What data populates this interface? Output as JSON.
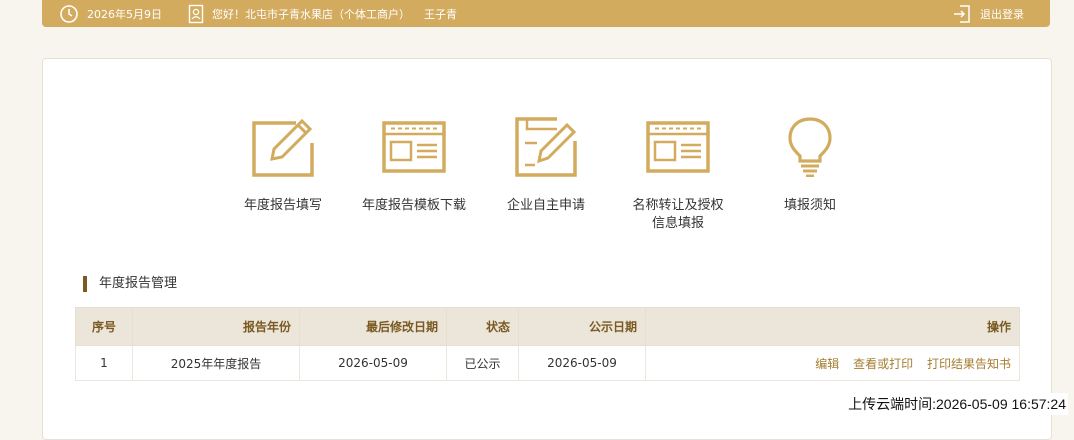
{
  "topbar": {
    "date": "2026年5月9日",
    "greeting": "您好！北屯市子青水果店（个体工商户）",
    "user": "王子青",
    "logout": "退出登录"
  },
  "menu": [
    {
      "label": "年度报告填写",
      "icon": "edit-form-icon"
    },
    {
      "label": "年度报告模板下载",
      "icon": "template-window-icon"
    },
    {
      "label": "企业自主申请",
      "icon": "apply-edit-icon"
    },
    {
      "label": "名称转让及授权信息填报",
      "icon": "template-window-icon"
    },
    {
      "label": "填报须知",
      "icon": "lightbulb-icon"
    }
  ],
  "section": {
    "title": "年度报告管理"
  },
  "table": {
    "headers": [
      "序号",
      "报告年份",
      "最后修改日期",
      "状态",
      "公示日期",
      "操作"
    ],
    "rows": [
      {
        "index": "1",
        "year": "2025年年度报告",
        "modified": "2026-05-09",
        "status": "已公示",
        "published": "2026-05-09",
        "ops": [
          "编辑",
          "查看或打印",
          "打印结果告知书"
        ]
      }
    ]
  },
  "upload_time": "上传云端时间:2026-05-09 16:57:24",
  "colors": {
    "accent": "#d3ab5e",
    "header_bg": "#ece5d9",
    "link": "#a57d32"
  }
}
